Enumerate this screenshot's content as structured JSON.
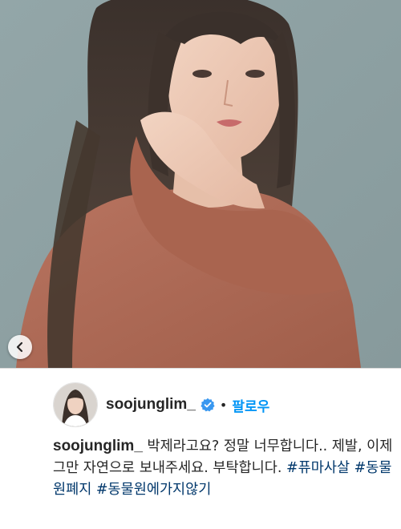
{
  "post": {
    "username": "soojunglim_",
    "separator": "•",
    "follow_label": "팔로우",
    "caption": {
      "username": "soojunglim_",
      "text": " 박제라고요? 정말 너무합니다.. 제발, 이제 그만 자연으로 보내주세요. 부탁합니다. ",
      "hashtags": [
        "#퓨마사살",
        "#동물원폐지",
        "#동물원에가지않기"
      ]
    }
  },
  "icons": {
    "prev": "chevron-left-icon",
    "verified": "verified-badge-icon"
  },
  "colors": {
    "follow": "#0095f6",
    "hashtag": "#00376b",
    "verified": "#3897f0",
    "photo_background": "#8fa1a3",
    "sweater": "#b06a55"
  }
}
